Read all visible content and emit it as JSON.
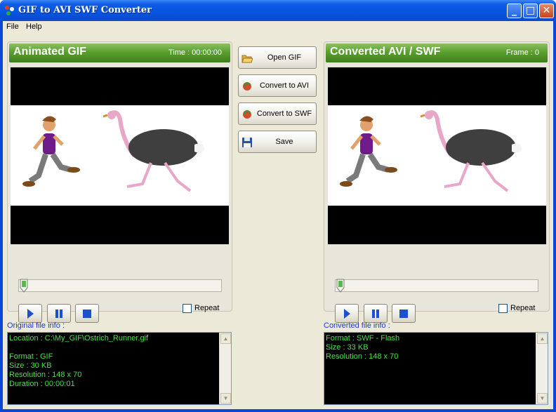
{
  "window": {
    "title": "GIF to AVI SWF Converter"
  },
  "menu": {
    "items": [
      "File",
      "Help"
    ]
  },
  "left_panel": {
    "title": "Animated GIF",
    "meta": "Time : 00:00:00",
    "repeat_label": "Repeat"
  },
  "right_panel": {
    "title": "Converted AVI / SWF",
    "meta": "Frame : 0",
    "repeat_label": "Repeat"
  },
  "actions": {
    "open_gif": "Open  GIF",
    "convert_avi": "Convert to AVI",
    "convert_swf": "Convert to SWF",
    "save": "Save"
  },
  "original_info": {
    "caption": "Original file info :",
    "text": "Location : C:\\My_GIF\\Ostrich_Runner.gif\n\nFormat : GIF\nSize : 30 KB\nResolution : 148 x 70\nDuration : 00:00:01"
  },
  "converted_info": {
    "caption": "Converted file info :",
    "text": "Format : SWF - Flash\nSize : 33 KB\nResolution : 148 x 70"
  },
  "playback": {
    "left_progress": 0.0,
    "right_progress": 0.0
  },
  "colors": {
    "header_green": "#5aa02e",
    "info_text": "#4de04d",
    "caption_blue": "#1b3ac9"
  },
  "icons": [
    "app-icon",
    "minimize-icon",
    "maximize-icon",
    "close-icon",
    "folder-open-icon",
    "convert-avi-icon",
    "convert-swf-icon",
    "floppy-disk-icon",
    "play-icon",
    "pause-icon",
    "stop-icon",
    "slider-thumb-icon"
  ]
}
